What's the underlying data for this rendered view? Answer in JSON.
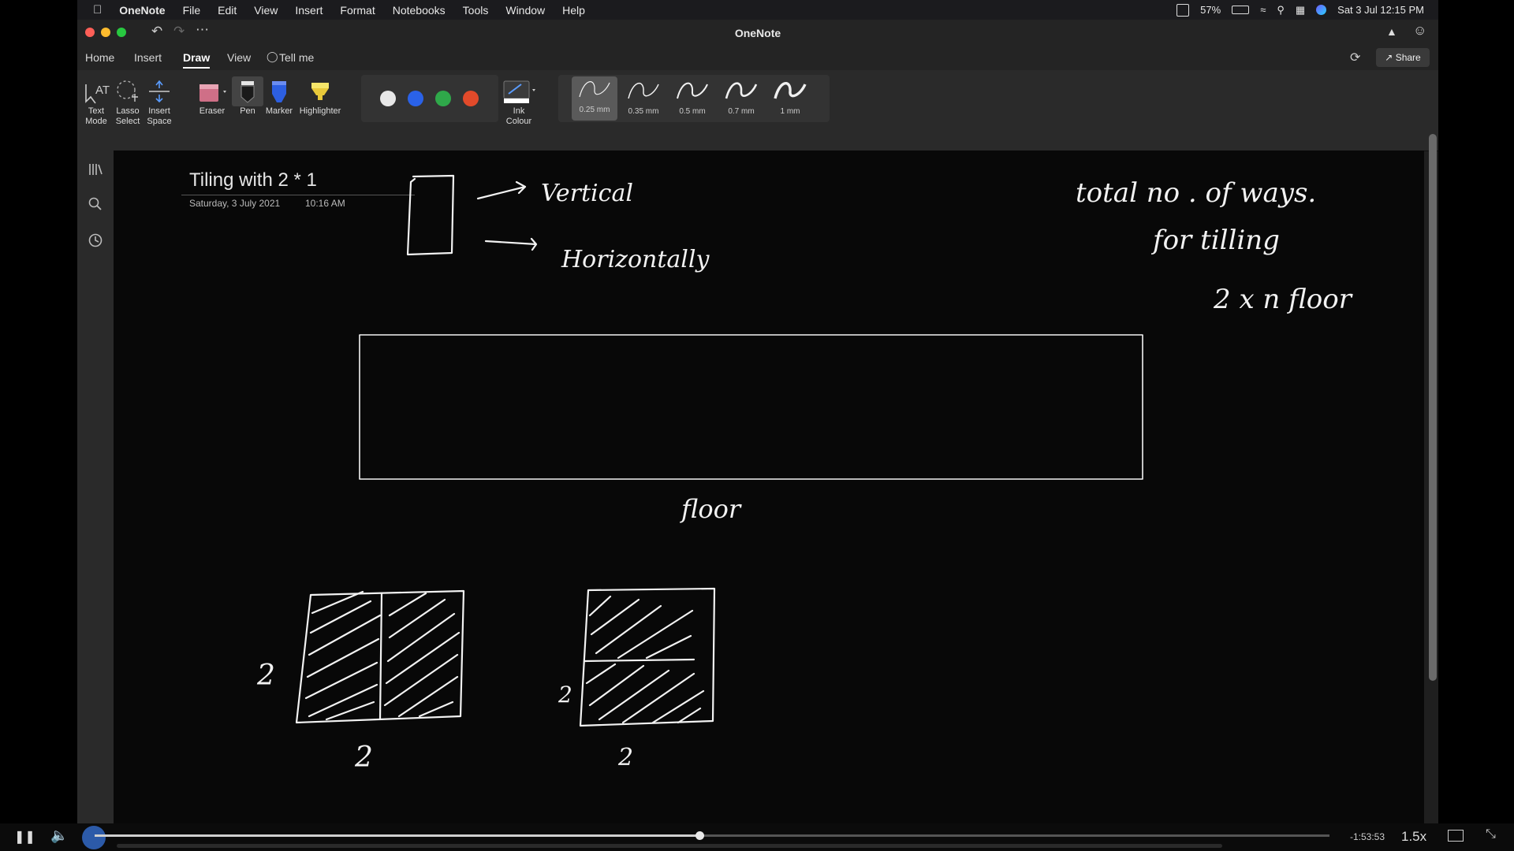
{
  "menubar": {
    "app": "OneNote",
    "items": [
      "File",
      "Edit",
      "View",
      "Insert",
      "Format",
      "Notebooks",
      "Tools",
      "Window",
      "Help"
    ],
    "battery": "57%",
    "datetime": "Sat 3 Jul  12:15 PM"
  },
  "window": {
    "title": "OneNote",
    "share_label": "Share"
  },
  "tabs": {
    "home": "Home",
    "insert": "Insert",
    "draw": "Draw",
    "view": "View",
    "tell_me": "Tell me"
  },
  "ribbon": {
    "text_mode": [
      "Text",
      "Mode"
    ],
    "lasso_select": [
      "Lasso",
      "Select"
    ],
    "insert_space": [
      "Insert",
      "Space"
    ],
    "eraser": "Eraser",
    "pen": "Pen",
    "marker": "Marker",
    "highlighter": "Highlighter",
    "ink_colour": [
      "Ink",
      "Colour"
    ],
    "colors": [
      "#e8e8e8",
      "#2a62e8",
      "#2fa84a",
      "#e24a2a"
    ],
    "pen_sizes": [
      "0.25 mm",
      "0.35 mm",
      "0.5 mm",
      "0.7 mm",
      "1 mm"
    ]
  },
  "page": {
    "title": "Tiling with 2 * 1",
    "date": "Saturday, 3 July 2021",
    "time": "10:16 AM"
  },
  "ink": {
    "vertical": "Vertical",
    "horizontally": "Horizontally",
    "note_line1": "total   no . of ways.",
    "note_line2": "for tilling",
    "note_line3": "2 x n  floor",
    "floor": "floor",
    "dim_a_left": "2",
    "dim_a_bottom": "2",
    "dim_b_left": "2",
    "dim_b_bottom": "2"
  },
  "player": {
    "time_remaining": "-1:53:53",
    "speed": "1.5x",
    "progress_fraction": 0.49
  }
}
